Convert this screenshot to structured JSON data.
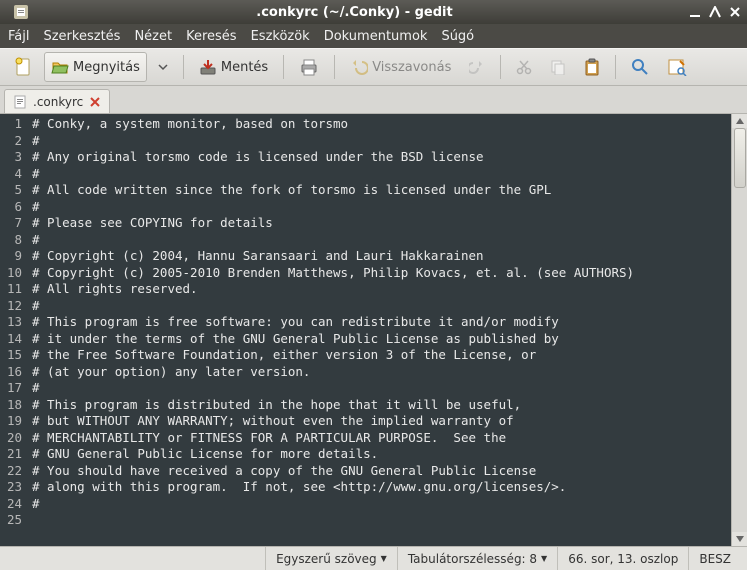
{
  "window": {
    "title": ".conkyrc (~/.Conky) - gedit"
  },
  "menu": {
    "file": "Fájl",
    "edit": "Szerkesztés",
    "view": "Nézet",
    "search": "Keresés",
    "tools": "Eszközök",
    "documents": "Dokumentumok",
    "help": "Súgó"
  },
  "toolbar": {
    "open_label": "Megnyitás",
    "save_label": "Mentés",
    "undo_label": "Visszavonás"
  },
  "tab": {
    "name": ".conkyrc"
  },
  "editor": {
    "lines": [
      "# Conky, a system monitor, based on torsmo",
      "#",
      "# Any original torsmo code is licensed under the BSD license",
      "#",
      "# All code written since the fork of torsmo is licensed under the GPL",
      "#",
      "# Please see COPYING for details",
      "#",
      "# Copyright (c) 2004, Hannu Saransaari and Lauri Hakkarainen",
      "# Copyright (c) 2005-2010 Brenden Matthews, Philip Kovacs, et. al. (see AUTHORS)",
      "# All rights reserved.",
      "#",
      "# This program is free software: you can redistribute it and/or modify",
      "# it under the terms of the GNU General Public License as published by",
      "# the Free Software Foundation, either version 3 of the License, or",
      "# (at your option) any later version.",
      "#",
      "# This program is distributed in the hope that it will be useful,",
      "# but WITHOUT ANY WARRANTY; without even the implied warranty of",
      "# MERCHANTABILITY or FITNESS FOR A PARTICULAR PURPOSE.  See the",
      "# GNU General Public License for more details.",
      "# You should have received a copy of the GNU General Public License",
      "# along with this program.  If not, see <http://www.gnu.org/licenses/>.",
      "#",
      ""
    ]
  },
  "status": {
    "language": "Egyszerű szöveg",
    "tabwidth": "Tabulátorszélesség: 8",
    "cursor": "66. sor, 13. oszlop",
    "insertmode": "BESZ"
  }
}
